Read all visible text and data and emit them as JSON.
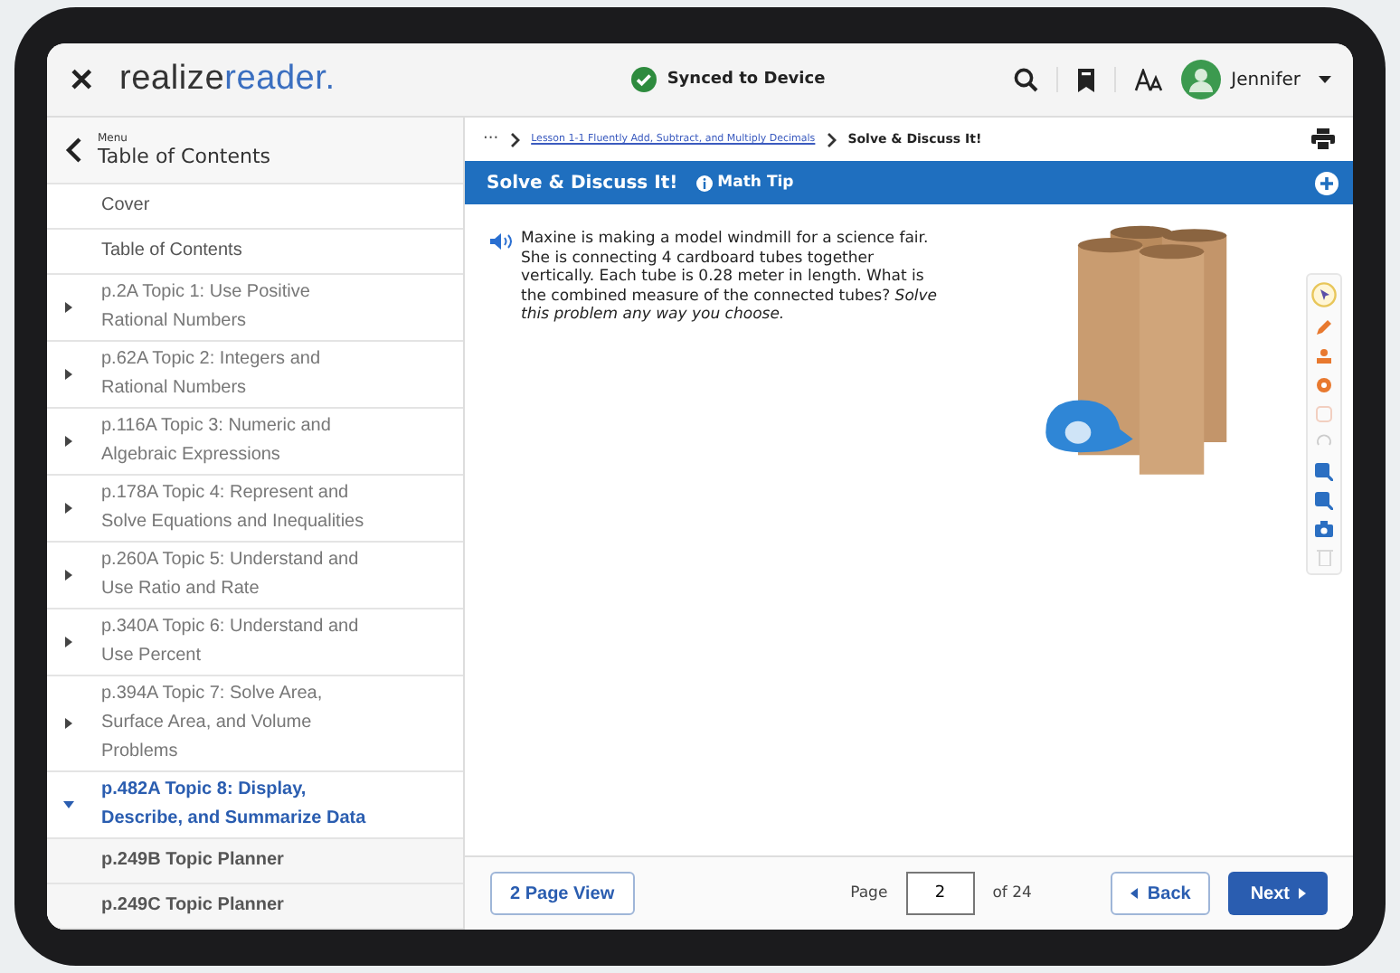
{
  "header": {
    "close": "✕",
    "logo": {
      "part1": "realize",
      "part2": "reader",
      "dot": "."
    },
    "sync_status": "Synced to Device",
    "user": "Jennifer"
  },
  "sidebar": {
    "menu_label": "Menu",
    "title": "Table of Contents",
    "items": [
      {
        "kind": "page",
        "label": "Cover"
      },
      {
        "kind": "page",
        "label": "Table of Contents"
      },
      {
        "kind": "topic",
        "label": "p.2A Topic 1: Use Positive Rational Numbers",
        "expanded": false,
        "selected": false
      },
      {
        "kind": "topic",
        "label": "p.62A Topic 2: Integers and Rational Numbers",
        "expanded": false,
        "selected": false
      },
      {
        "kind": "topic",
        "label": "p.116A Topic 3: Numeric and Algebraic Expressions",
        "expanded": false,
        "selected": false
      },
      {
        "kind": "topic",
        "label": "p.178A Topic 4: Represent and Solve Equations and Inequalities",
        "expanded": false,
        "selected": false
      },
      {
        "kind": "topic",
        "label": "p.260A Topic 5: Understand and Use Ratio and Rate",
        "expanded": false,
        "selected": false
      },
      {
        "kind": "topic",
        "label": "p.340A Topic 6: Understand and Use Percent",
        "expanded": false,
        "selected": false
      },
      {
        "kind": "topic",
        "label": "p.394A Topic 7: Solve Area, Surface Area, and Volume Problems",
        "expanded": false,
        "selected": false
      },
      {
        "kind": "topic",
        "label": "p.482A Topic 8: Display, Describe, and Summarize Data",
        "expanded": true,
        "selected": true,
        "children": [
          {
            "label": "p.249B Topic Planner"
          },
          {
            "label": "p.249C Topic Planner"
          }
        ]
      }
    ]
  },
  "breadcrumb": {
    "ellipsis": "···",
    "link": "Lesson 1-1 Fluently Add, Subtract, and Multiply Decimals",
    "current": "Solve & Discuss It!"
  },
  "banner": {
    "title": "Solve & Discuss It!",
    "tip": "Math Tip"
  },
  "problem": {
    "text": "Maxine is making a model windmill for a science fair. She is connecting 4 cardboard tubes together vertically. Each tube is 0.28 meter in length. What is the combined measure of the connected tubes? *Solve this problem any way you choose.*"
  },
  "footer": {
    "two_page": "2 Page View",
    "page_label": "Page",
    "page_value": "2",
    "page_total": "of 24",
    "back": "Back",
    "next": "Next"
  }
}
